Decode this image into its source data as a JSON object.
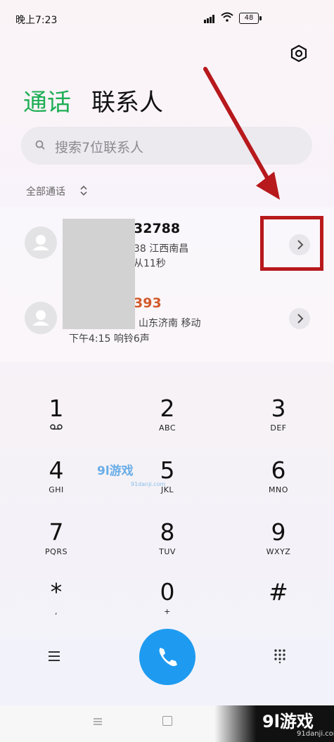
{
  "status_bar": {
    "time": "晚上7:23",
    "battery": "48"
  },
  "tabs": {
    "calls": "通话",
    "contacts": "联系人"
  },
  "search": {
    "placeholder": "搜索7位联系人"
  },
  "filter": {
    "label": "全部通话"
  },
  "calls": [
    {
      "number_visible": "32788",
      "detail_line1": "38  江西南昌",
      "detail_line2": "从11秒"
    },
    {
      "number_visible": "393",
      "detail_line1": "山东济南 移动",
      "detail_line2": "下午4:15 响铃6声"
    }
  ],
  "keypad": [
    {
      "digit": "1",
      "letters": ""
    },
    {
      "digit": "2",
      "letters": "ABC"
    },
    {
      "digit": "3",
      "letters": "DEF"
    },
    {
      "digit": "4",
      "letters": "GHI"
    },
    {
      "digit": "5",
      "letters": "JKL"
    },
    {
      "digit": "6",
      "letters": "MNO"
    },
    {
      "digit": "7",
      "letters": "PQRS"
    },
    {
      "digit": "8",
      "letters": "TUV"
    },
    {
      "digit": "9",
      "letters": "WXYZ"
    },
    {
      "digit": "*",
      "letters": ","
    },
    {
      "digit": "0",
      "letters": "+"
    },
    {
      "digit": "#",
      "letters": ""
    }
  ],
  "watermark": {
    "logo": "9l游戏",
    "site": "91danji.com",
    "center_logo": "9l游戏",
    "center_site": "91danji.com"
  },
  "colors": {
    "accent_green": "#1fae56",
    "dial_blue": "#1e9bf0",
    "missed_red": "#d35a2c",
    "annotation_red": "#b7191c"
  }
}
